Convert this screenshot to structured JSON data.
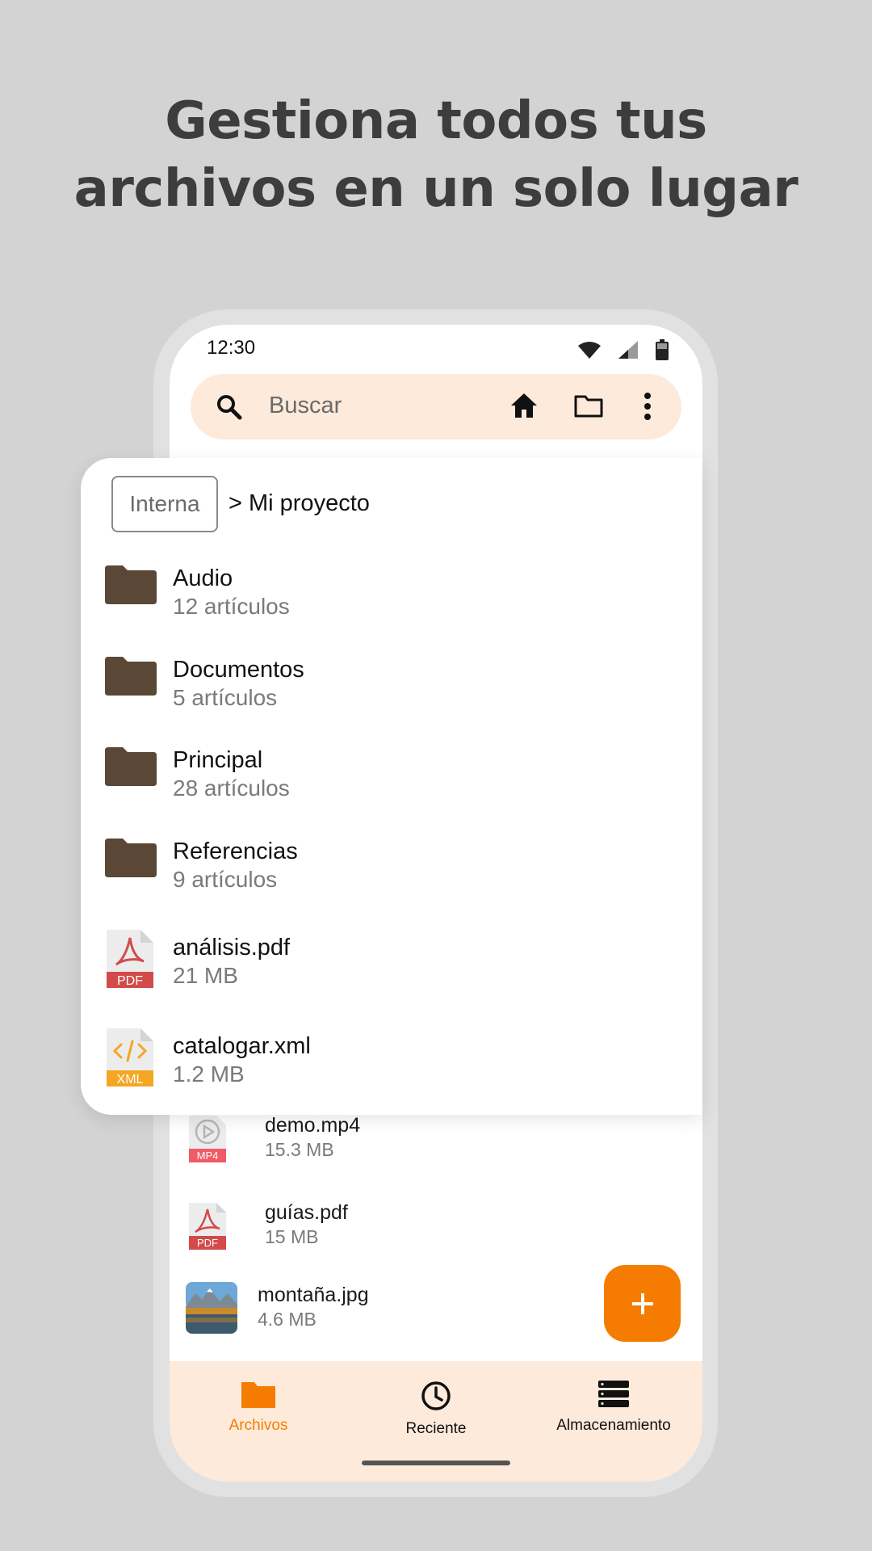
{
  "headline": {
    "line1": "Gestiona todos tus",
    "line2": "archivos en un solo lugar"
  },
  "status": {
    "time": "12:30"
  },
  "search": {
    "placeholder": "Buscar"
  },
  "breadcrumb": {
    "root": "Interna",
    "path": "> Mi proyecto"
  },
  "card_items": [
    {
      "name": "Audio",
      "meta": "12 artículos",
      "icon": "folder-icon"
    },
    {
      "name": "Documentos",
      "meta": "5 artículos",
      "icon": "folder-icon"
    },
    {
      "name": "Principal",
      "meta": "28 artículos",
      "icon": "folder-icon"
    },
    {
      "name": "Referencias",
      "meta": "9 artículos",
      "icon": "folder-icon"
    },
    {
      "name": "análisis.pdf",
      "meta": "21 MB",
      "icon": "pdf-file-icon",
      "badge": "PDF"
    },
    {
      "name": "catalogar.xml",
      "meta": "1.2 MB",
      "icon": "xml-file-icon",
      "badge": "XML"
    }
  ],
  "background_items": [
    {
      "name": "demo.mp4",
      "meta": "15.3 MB",
      "icon": "mp4-file-icon",
      "badge": "MP4"
    },
    {
      "name": "guías.pdf",
      "meta": "15 MB",
      "icon": "pdf-file-icon",
      "badge": "PDF"
    },
    {
      "name": "montaña.jpg",
      "meta": "4.6 MB",
      "icon": "image-thumbnail"
    }
  ],
  "fab": {
    "label": "+"
  },
  "nav": [
    {
      "label": "Archivos",
      "icon": "folder-icon",
      "active": true
    },
    {
      "label": "Reciente",
      "icon": "clock-icon",
      "active": false
    },
    {
      "label": "Almacenamiento",
      "icon": "storage-icon",
      "active": false
    }
  ],
  "colors": {
    "background": "#d3d3d3",
    "accent": "#f57c00",
    "searchbar": "#fdeadb",
    "folder": "#5a4736",
    "pdf": "#d24a4a",
    "xml": "#f5a623",
    "mp4": "#ef5b66"
  }
}
